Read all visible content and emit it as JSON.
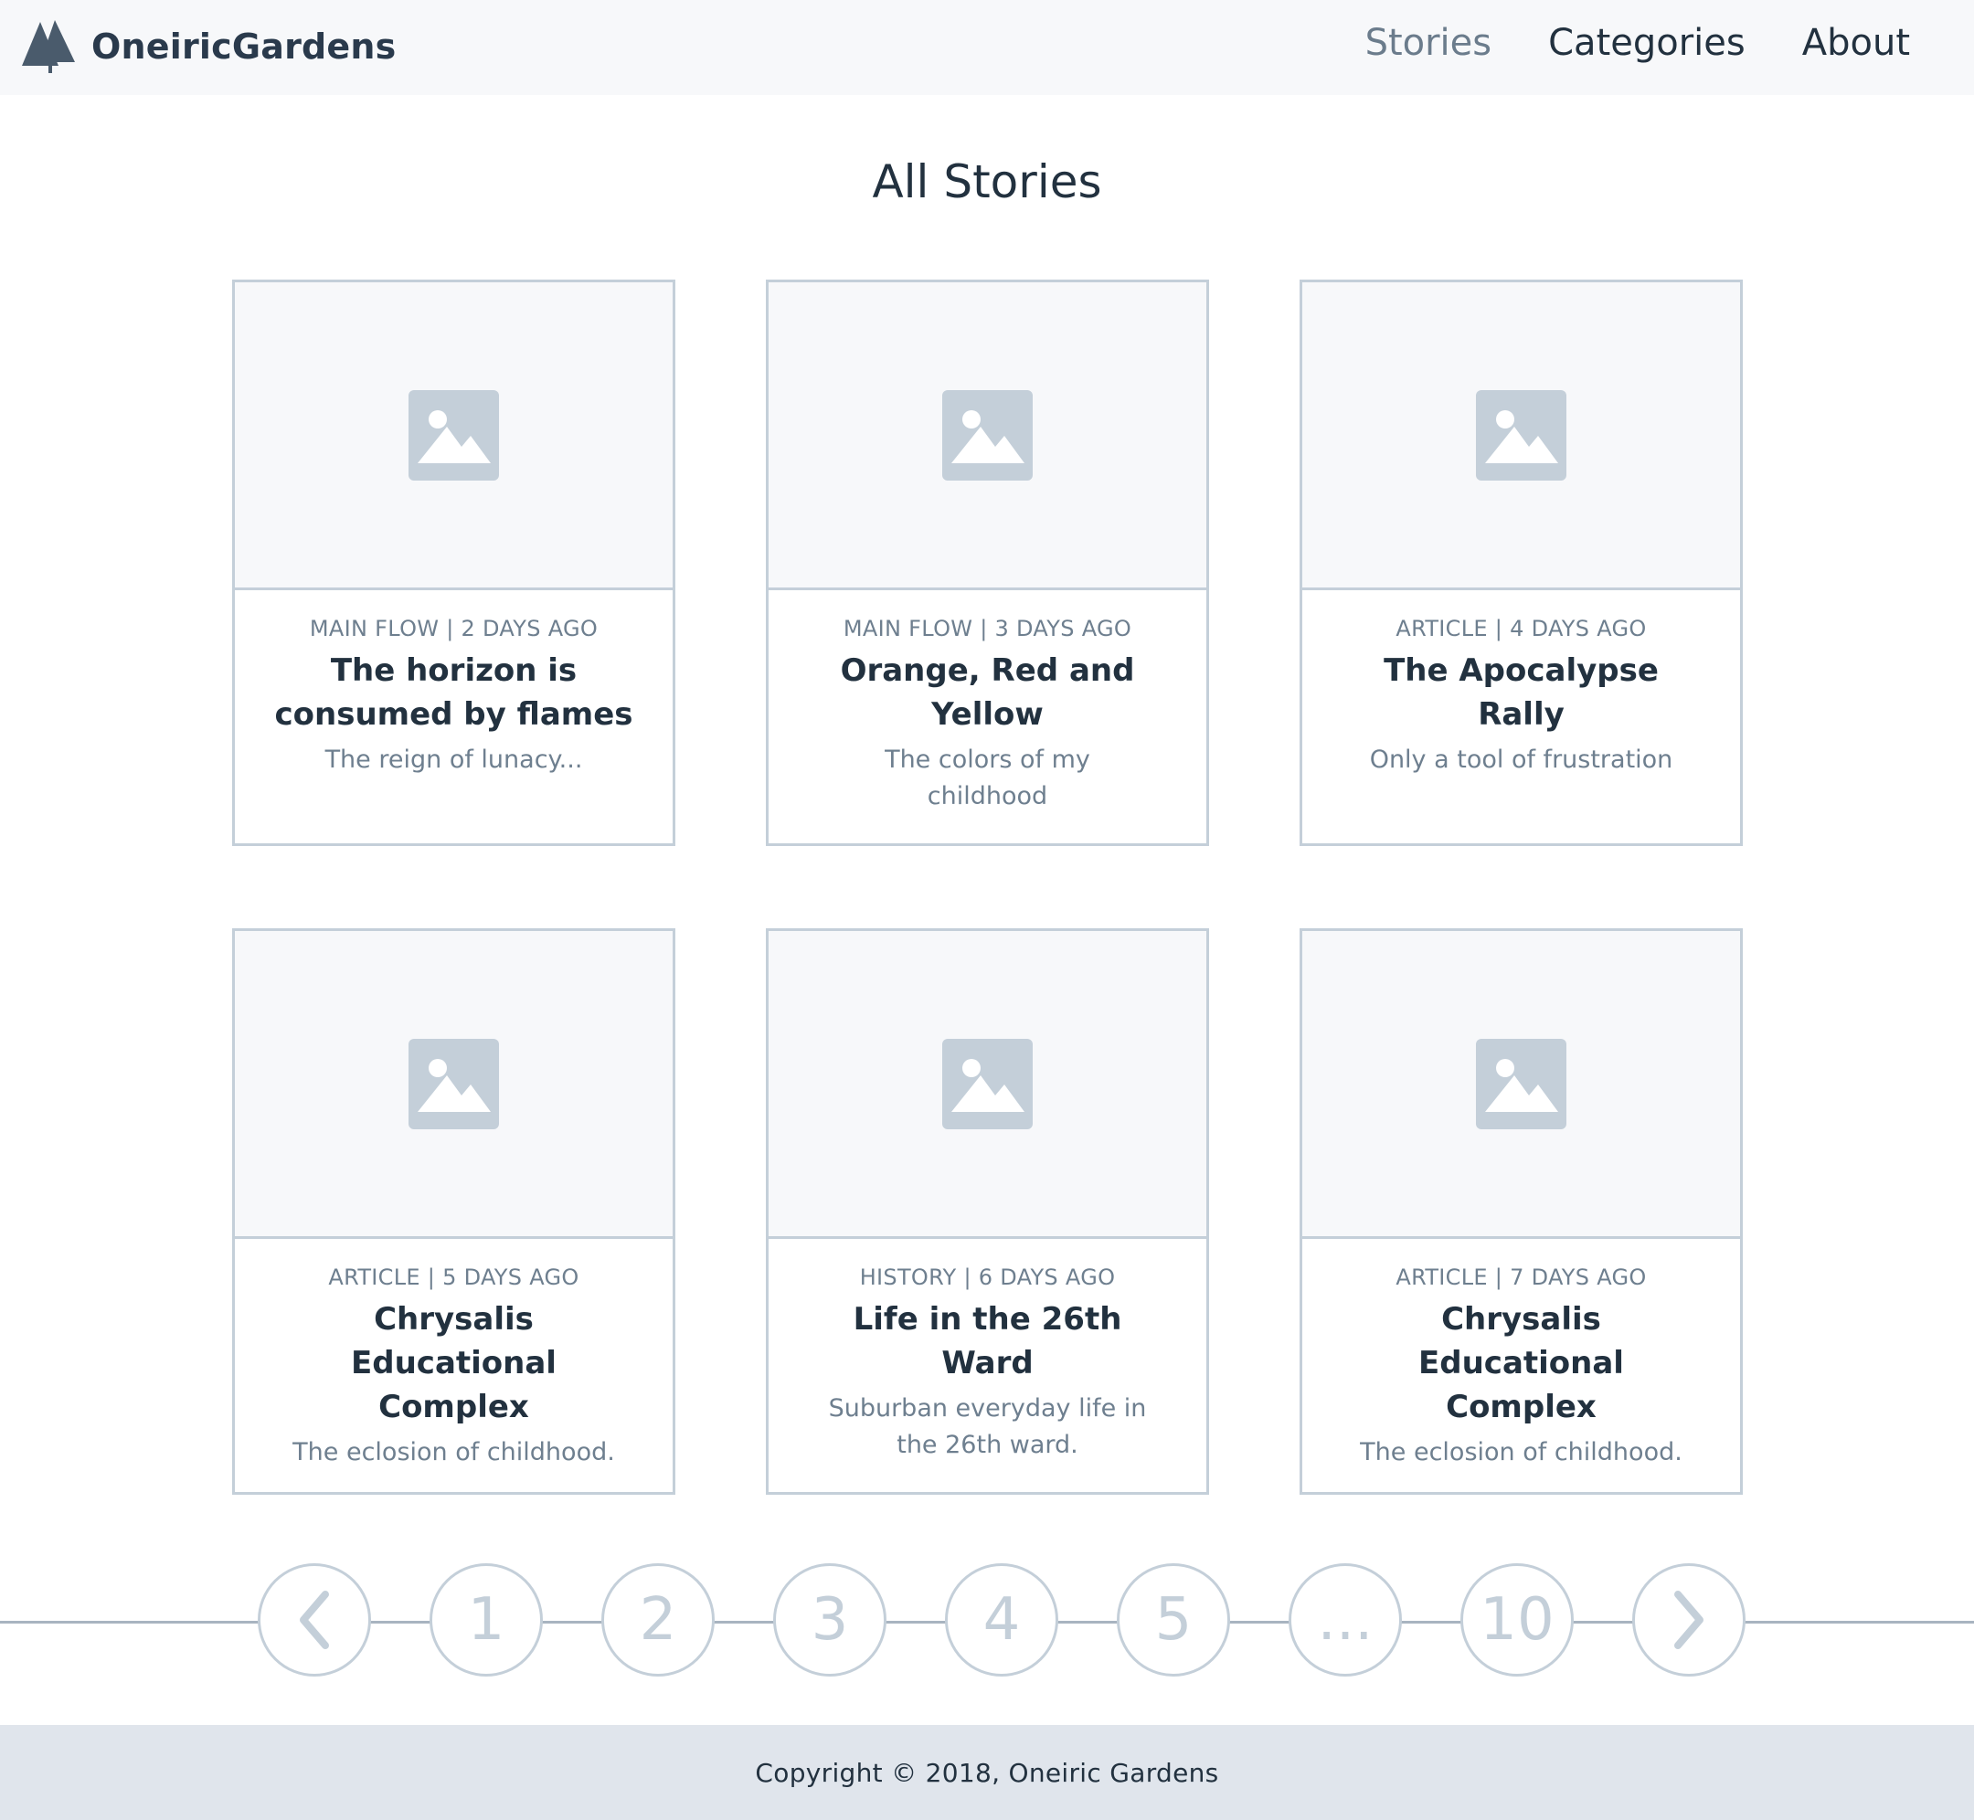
{
  "header": {
    "brand": "OneiricGardens",
    "logo_icon": "tree-icon",
    "nav": [
      {
        "label": "Stories",
        "active": true
      },
      {
        "label": "Categories",
        "active": false
      },
      {
        "label": "About",
        "active": false
      }
    ]
  },
  "main": {
    "title": "All Stories",
    "cards": [
      {
        "meta": "MAIN FLOW | 2 DAYS AGO",
        "title": "The horizon is consumed by flames",
        "subtitle": "The reign of lunacy...",
        "image_icon": "image-placeholder-icon"
      },
      {
        "meta": "MAIN FLOW | 3 DAYS AGO",
        "title": "Orange, Red and Yellow",
        "subtitle": "The colors of my childhood",
        "image_icon": "image-placeholder-icon"
      },
      {
        "meta": "ARTICLE | 4 DAYS AGO",
        "title": "The Apocalypse Rally",
        "subtitle": "Only a tool of frustration",
        "image_icon": "image-placeholder-icon"
      },
      {
        "meta": "ARTICLE | 5 DAYS AGO",
        "title": "Chrysalis Educational Complex",
        "subtitle": "The eclosion of childhood.",
        "image_icon": "image-placeholder-icon"
      },
      {
        "meta": "HISTORY | 6 DAYS AGO",
        "title": "Life in the 26th Ward",
        "subtitle": "Suburban everyday life in the 26th ward.",
        "image_icon": "image-placeholder-icon"
      },
      {
        "meta": "ARTICLE | 7 DAYS AGO",
        "title": "Chrysalis Educational Complex",
        "subtitle": "The eclosion of childhood.",
        "image_icon": "image-placeholder-icon"
      }
    ]
  },
  "pagination": {
    "prev_icon": "chevron-left-icon",
    "next_icon": "chevron-right-icon",
    "pages": [
      "1",
      "2",
      "3",
      "4",
      "5",
      "...",
      "10"
    ]
  },
  "footer": {
    "copyright": "Copyright © 2018, Oneiric Gardens"
  },
  "colors": {
    "header_bg": "#f7f8fa",
    "border": "#c4cfd9",
    "text_dark": "#22313f",
    "text_muted": "#6e7f8f",
    "footer_bg": "#e0e5ec"
  }
}
